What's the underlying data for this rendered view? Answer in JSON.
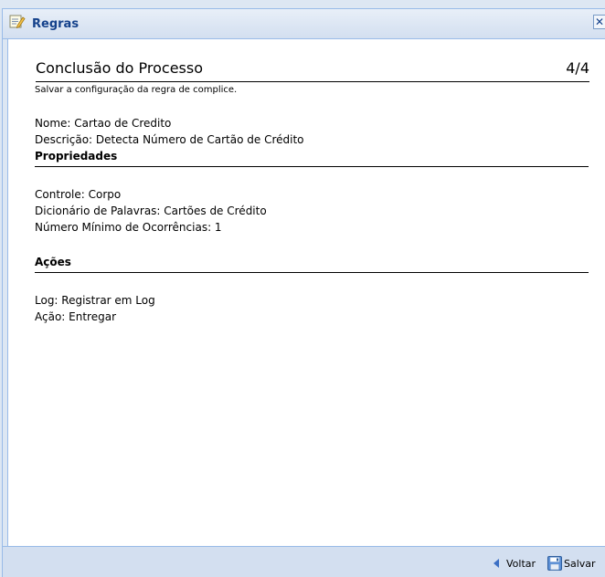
{
  "window": {
    "title": "Regras",
    "close_glyph": "✕"
  },
  "wizard": {
    "heading": "Conclusão do Processo",
    "step": "4/4",
    "subtitle": "Salvar a configuração da regra de complice."
  },
  "rule": {
    "name_line": "Nome: Cartao de Credito",
    "description_line": "Descrição: Detecta Número de Cartão de Crédito"
  },
  "properties": {
    "heading": "Propriedades",
    "control_line": "Controle: Corpo",
    "dictionary_line": "Dicionário de Palavras: Cartões de Crédito",
    "min_occurrences_line": "Número Mínimo de Ocorrências: 1"
  },
  "actions": {
    "heading": "Ações",
    "log_line": "Log: Registrar em Log",
    "action_line": "Ação: Entregar"
  },
  "footer": {
    "back_label": "Voltar",
    "save_label": "Salvar"
  },
  "icons": {
    "title_icon": "rules-edit-icon",
    "back_icon": "arrow-left-icon",
    "save_icon": "floppy-disk-icon",
    "close_icon": "close-icon"
  },
  "colors": {
    "title_text": "#15428b",
    "frame_border": "#99bbe8",
    "frame_fill": "#d3dff0",
    "back_arrow": "#3b6fc4"
  }
}
